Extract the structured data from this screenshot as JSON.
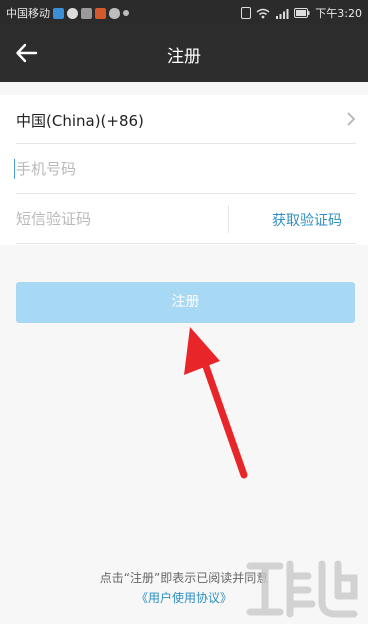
{
  "status_bar": {
    "carrier": "中国移动",
    "time": "下午3:20"
  },
  "nav": {
    "title": "注册",
    "back_icon": "arrow-left-icon"
  },
  "form": {
    "country_label": "中国(China)(+86)",
    "phone_placeholder": "手机号码",
    "sms_placeholder": "短信验证码",
    "get_code_label": "获取验证码"
  },
  "register_button": "注册",
  "terms": {
    "text": "点击“注册”即表示已阅读并同意",
    "link": "《用户使用协议》"
  },
  "colors": {
    "navbar": "#2d2d2d",
    "button": "#a8d9f4",
    "link": "#2f8fc2",
    "annotation_arrow": "#e8262a"
  }
}
